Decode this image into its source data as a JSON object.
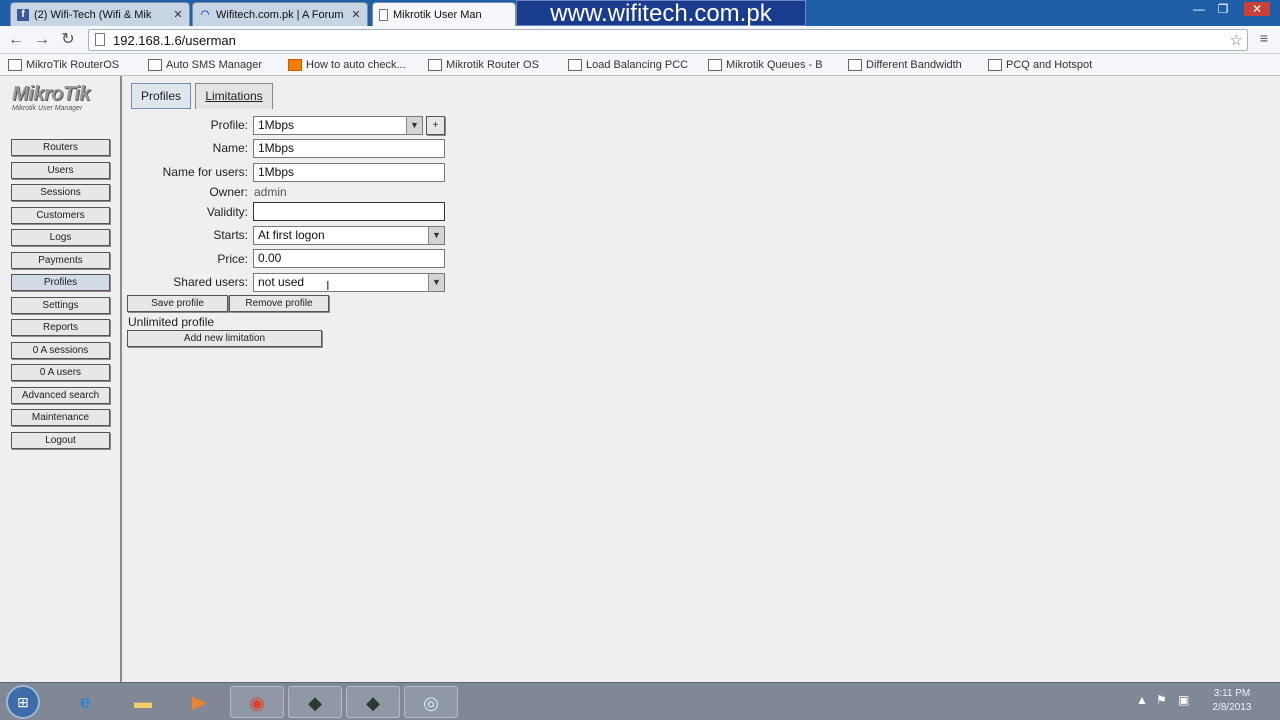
{
  "browser": {
    "tabs": [
      {
        "label": "(2) Wifi-Tech (Wifi & Mik",
        "icon": "facebook-icon",
        "close": "✕"
      },
      {
        "label": "Wifitech.com.pk | A Forum",
        "icon": "wifi-icon",
        "close": "✕"
      },
      {
        "label": "Mikrotik User Man",
        "icon": "page-icon",
        "close": "✕"
      }
    ],
    "banner": "www.wifitech.com.pk",
    "window_controls": {
      "minimize": "—",
      "maximize": "❐",
      "close": "✕"
    },
    "url": "192.168.1.6/userman",
    "bookmarks": [
      "MikroTik RouterOS",
      "Auto SMS Manager",
      "How to auto check...",
      "Mikrotik Router OS",
      "Load Balancing PCC",
      "Mikrotik Queues - B",
      "Different Bandwidth",
      "PCQ and Hotspot"
    ],
    "accent": "#1f5fa8"
  },
  "app": {
    "logo": {
      "main": "MikroTik",
      "sub": "Mikrotik User Manager"
    },
    "nav": [
      "Routers",
      "Users",
      "Sessions",
      "Customers",
      "Logs",
      "Payments",
      "Profiles",
      "Settings",
      "Reports",
      "0 A sessions",
      "0 A users",
      "Advanced search",
      "Maintenance",
      "Logout"
    ],
    "active_nav": "Profiles",
    "tabs": {
      "profiles": "Profiles",
      "limitations": "Limitations"
    },
    "form": {
      "profile_label": "Profile:",
      "profile_value": "1Mbps",
      "profile_add": "+",
      "name_label": "Name:",
      "name_value": "1Mbps",
      "users_name_label": "Name for users:",
      "users_name_value": "1Mbps",
      "owner_label": "Owner:",
      "owner_value": "admin",
      "validity_label": "Validity:",
      "validity_value": "",
      "starts_label": "Starts:",
      "starts_value": "At first logon",
      "price_label": "Price:",
      "price_value": "0.00",
      "shared_label": "Shared users:",
      "shared_value": "not used"
    },
    "buttons": {
      "save": "Save profile",
      "remove": "Remove profile",
      "add_limitation": "Add new limitation"
    },
    "unlimited_text": "Unlimited profile"
  },
  "taskbar": {
    "clock_time": "3:11 PM",
    "clock_date": "2/8/2013",
    "apps": [
      "internet-explorer-icon",
      "folder-icon",
      "media-player-icon",
      "chrome-icon",
      "winbox-icon",
      "winbox-icon",
      "network-icon"
    ]
  }
}
